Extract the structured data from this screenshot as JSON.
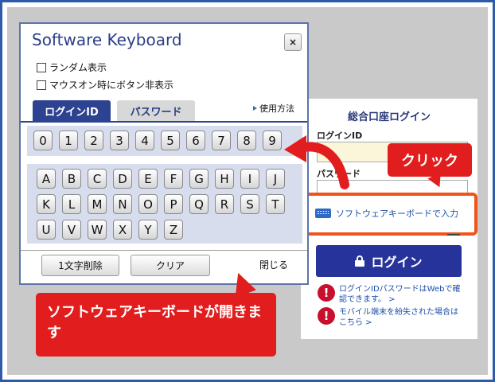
{
  "keyboard": {
    "title": "Software Keyboard",
    "close_icon": "×",
    "options": [
      "ランダム表示",
      "マウスオン時にボタン非表示"
    ],
    "tabs": [
      "ログインID",
      "パスワード"
    ],
    "help_link": "使用方法",
    "number_keys": [
      "0",
      "1",
      "2",
      "3",
      "4",
      "5",
      "6",
      "7",
      "8",
      "9"
    ],
    "alpha_rows": [
      [
        "A",
        "B",
        "C",
        "D",
        "E",
        "F",
        "G",
        "H",
        "I",
        "J"
      ],
      [
        "K",
        "L",
        "M",
        "N",
        "O",
        "P",
        "Q",
        "R",
        "S",
        "T"
      ],
      [
        "U",
        "V",
        "W",
        "X",
        "Y",
        "Z"
      ]
    ],
    "delete_label": "1文字削除",
    "clear_label": "クリア",
    "close_label": "閉じる"
  },
  "login": {
    "title": "総合口座ログイン",
    "id_label": "ログインID",
    "pw_label": "パスワード",
    "software_keyboard_link": "ソフトウェアキーボードで入力",
    "login_button": "ログイン",
    "notices": [
      "ログインIDパスワードはWebで確認できます。 >",
      "モバイル端末を紛失された場合はこちら >"
    ],
    "warn_icon": "!"
  },
  "callouts": {
    "click": "クリック",
    "opens": "ソフトウェアキーボードが開きます"
  },
  "colors": {
    "accent": "#2d4290",
    "callout": "#e21d1d",
    "highlight_border": "#f0541a"
  }
}
